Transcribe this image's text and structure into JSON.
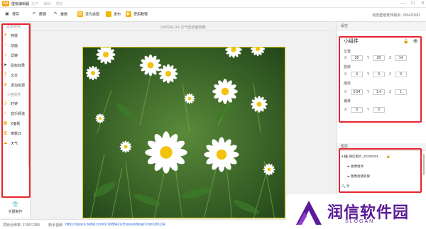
{
  "app": {
    "logo": "AA",
    "title": "壁纸编辑器",
    "menus": [
      "文件",
      "编辑",
      "帮助"
    ],
    "win_controls": [
      "—",
      "☐",
      "✕"
    ]
  },
  "toolbar": {
    "items": [
      {
        "label": "保存",
        "icon": "save-icon"
      },
      {
        "label": "撤销",
        "icon": "undo-icon"
      },
      {
        "label": "重做",
        "icon": "redo-icon"
      },
      {
        "label": "设为桌面",
        "icon": "set-desktop-icon"
      },
      {
        "label": "发布",
        "icon": "publish-icon"
      },
      {
        "label": "使用教程",
        "icon": "tutorial-icon"
      }
    ],
    "version": "动态壁纸软件版本: 250470182"
  },
  "left_panel": {
    "group1": "壁纸特效",
    "items1": [
      {
        "label": "特效",
        "icon": "wand-icon"
      },
      {
        "label": "动画",
        "icon": "animation-icon"
      },
      {
        "label": "滤镜",
        "icon": "filter-icon"
      },
      {
        "label": "鼠标效果",
        "icon": "cursor-icon"
      },
      {
        "label": "文本",
        "icon": "text-icon"
      },
      {
        "label": "添加资源",
        "icon": "add-resource-icon"
      }
    ],
    "group2": "小挂组件",
    "items2": [
      {
        "label": "时钟",
        "icon": "clock-icon"
      },
      {
        "label": "音乐频谱",
        "icon": "music-icon"
      },
      {
        "label": "X面板",
        "icon": "panel-icon"
      },
      {
        "label": "倒数日",
        "icon": "calendar-icon"
      },
      {
        "label": "天气",
        "icon": "weather-icon"
      }
    ],
    "footer": "主题制作"
  },
  "canvas": {
    "title": "1685241114-元气壁纸编辑器"
  },
  "properties": {
    "header": "属性",
    "widget_name": "小组件",
    "icons": [
      "lock-icon",
      "eye-icon"
    ],
    "position": {
      "label": "位置",
      "x": "20",
      "y": "20",
      "z": "14"
    },
    "rotation": {
      "label": "旋转",
      "x": "0",
      "y": "0",
      "z": "0"
    },
    "scale": {
      "label": "缩放",
      "x": "0.94",
      "y": "1.4",
      "z": "1"
    },
    "offset": {
      "label": "偏移",
      "x": "0",
      "y": "0"
    }
  },
  "layers": {
    "header": "图层",
    "items": [
      "微信图片_2023042l1...",
      "图像组件",
      "图像滤镜效果",
      "外"
    ]
  },
  "status": {
    "resolution": "项目分辨率: 1706*1280",
    "tutorial_label": "新手视频:",
    "tutorial_url": "https://space.bilibili.com/670888431/channel/detail?cid=189134"
  },
  "watermark": {
    "title": "润信软件园",
    "subtitle": "SLOGAN"
  }
}
